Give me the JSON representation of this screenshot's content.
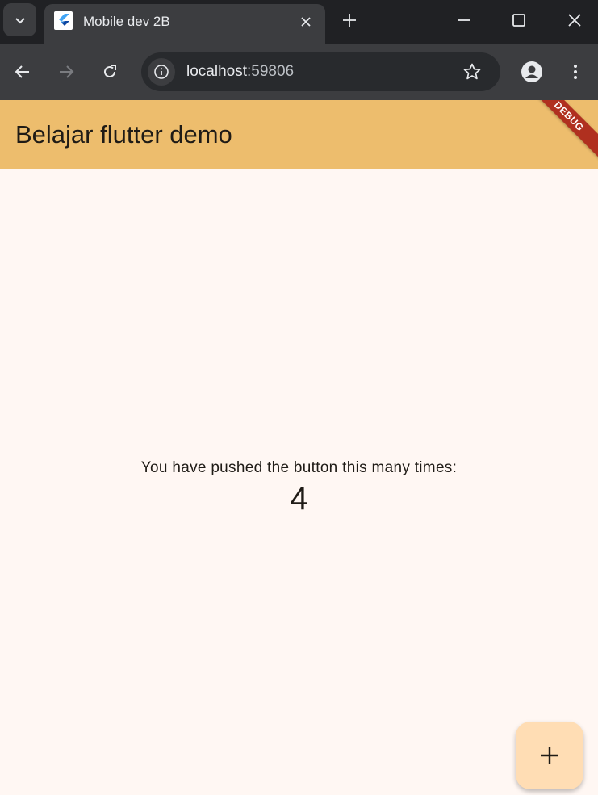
{
  "browser": {
    "tab": {
      "title": "Mobile dev 2B",
      "favicon": "flutter-icon"
    },
    "address": {
      "host": "localhost",
      "port": ":59806"
    },
    "icons": {
      "tab_search": "chevron-down-icon",
      "tab_close": "close-icon",
      "new_tab": "plus-icon",
      "minimize": "minimize-icon",
      "maximize": "maximize-icon",
      "close_window": "close-icon",
      "back": "arrow-left-icon",
      "forward": "arrow-right-icon",
      "reload": "reload-icon",
      "site_info": "info-icon",
      "bookmark": "star-icon",
      "profile": "profile-icon",
      "menu": "more-vertical-icon"
    }
  },
  "app": {
    "title": "Belajar flutter demo",
    "debug_banner": "DEBUG",
    "message": "You have pushed the button this many times:",
    "counter": "4",
    "fab_icon": "plus-icon",
    "colors": {
      "appbar": "#edbd6d",
      "background": "#fff7f3",
      "fab": "#ffddb4",
      "debug": "#b0301f"
    }
  }
}
